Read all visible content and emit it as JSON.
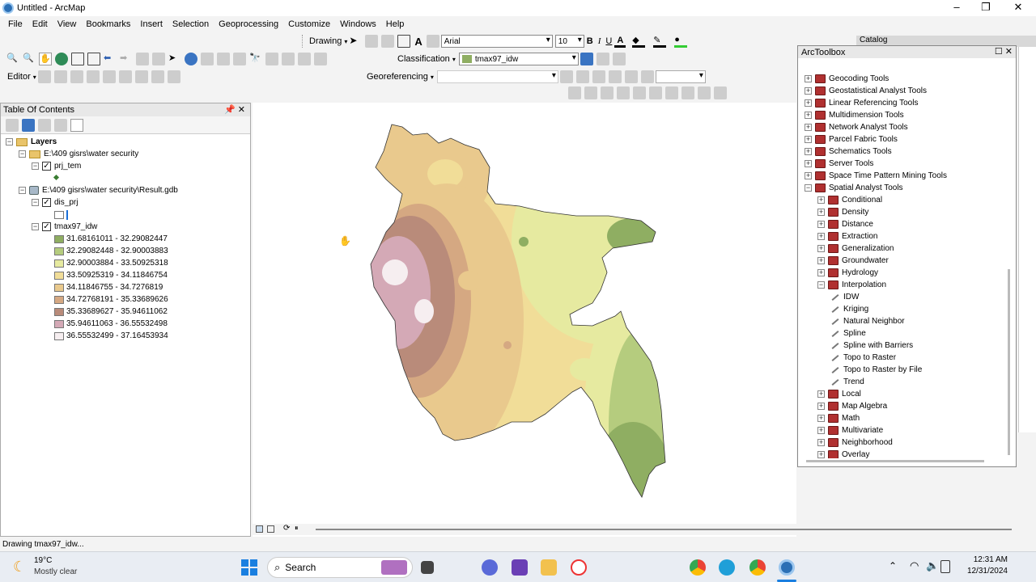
{
  "window": {
    "title": "Untitled - ArcMap"
  },
  "menu": [
    "File",
    "Edit",
    "View",
    "Bookmarks",
    "Insert",
    "Selection",
    "Geoprocessing",
    "Customize",
    "Windows",
    "Help"
  ],
  "toolbars": {
    "drawing_label": "Drawing",
    "font_name": "Arial",
    "font_size": "10",
    "bold": "B",
    "italic": "I",
    "underline": "U",
    "classification_label": "Classification",
    "layer_select": "tmax97_idw",
    "editor_label": "Editor",
    "georeferencing_label": "Georeferencing"
  },
  "toc": {
    "title": "Table Of Contents",
    "layers_label": "Layers",
    "groups": [
      {
        "path": "E:\\409 gisrs\\water security",
        "layers": [
          {
            "name": "prj_tem"
          }
        ]
      },
      {
        "path": "E:\\409 gisrs\\water security\\Result.gdb",
        "layers": [
          {
            "name": "dis_prj"
          },
          {
            "name": "tmax97_idw"
          }
        ]
      }
    ],
    "legend": [
      {
        "range": "31.68161011 - 32.29082447",
        "color": "#8fae62"
      },
      {
        "range": "32.29082448 - 32.90003883",
        "color": "#b5cc7e"
      },
      {
        "range": "32.90003884 - 33.50925318",
        "color": "#e6eaa0"
      },
      {
        "range": "33.50925319 - 34.11846754",
        "color": "#f1dd98"
      },
      {
        "range": "34.11846755 - 34.7276819",
        "color": "#e9c98d"
      },
      {
        "range": "34.72768191 - 35.33689626",
        "color": "#d5a882"
      },
      {
        "range": "35.33689627 - 35.94611062",
        "color": "#b98b7a"
      },
      {
        "range": "35.94611063 - 36.55532498",
        "color": "#d4a9b6"
      },
      {
        "range": "36.55532499 - 37.16453934",
        "color": "#f6eef0"
      }
    ]
  },
  "arctoolbox": {
    "title": "ArcToolbox",
    "toolboxes": [
      "Geocoding Tools",
      "Geostatistical Analyst Tools",
      "Linear Referencing Tools",
      "Multidimension Tools",
      "Network Analyst Tools",
      "Parcel Fabric Tools",
      "Schematics Tools",
      "Server Tools",
      "Space Time Pattern Mining Tools",
      "Spatial Analyst Tools"
    ],
    "spatial_analyst": [
      "Conditional",
      "Density",
      "Distance",
      "Extraction",
      "Generalization",
      "Groundwater",
      "Hydrology",
      "Interpolation"
    ],
    "interpolation_tools": [
      "IDW",
      "Kriging",
      "Natural Neighbor",
      "Spline",
      "Spline with Barriers",
      "Topo to Raster",
      "Topo to Raster by File",
      "Trend"
    ],
    "after": [
      "Local",
      "Map Algebra",
      "Math",
      "Multivariate",
      "Neighborhood",
      "Overlay"
    ]
  },
  "catalog_tab": "Catalog",
  "status": "Drawing tmax97_idw...",
  "taskbar": {
    "weather_temp": "19°C",
    "weather_desc": "Mostly clear",
    "search": "Search",
    "time": "12:31 AM",
    "date": "12/31/2024"
  }
}
